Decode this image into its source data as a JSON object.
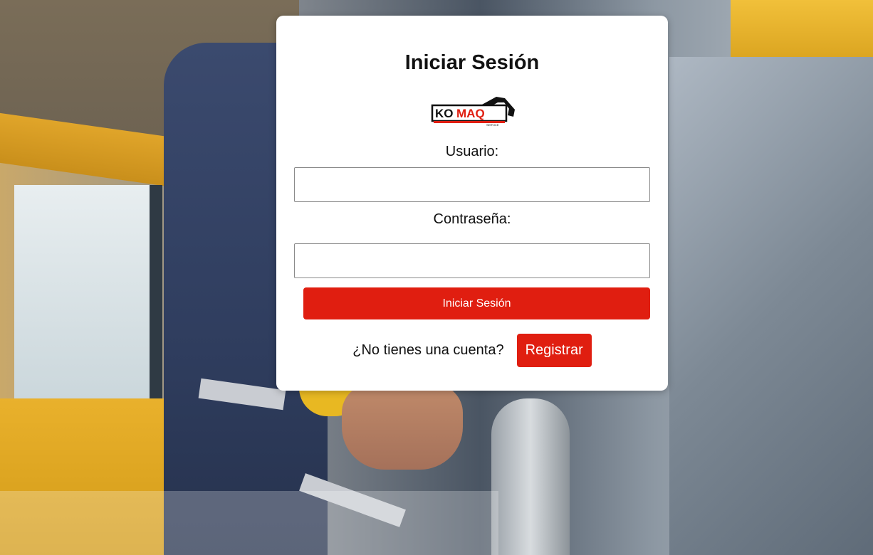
{
  "login": {
    "title": "Iniciar Sesión",
    "logo_text": "KOMAQ",
    "username_label": "Usuario:",
    "username_value": "",
    "password_label": "Contraseña:",
    "password_value": "",
    "submit_label": "Iniciar Sesión",
    "no_account_text": "¿No tienes una cuenta?",
    "register_label": "Registrar"
  },
  "colors": {
    "accent": "#e01e10",
    "card": "#ffffff"
  }
}
